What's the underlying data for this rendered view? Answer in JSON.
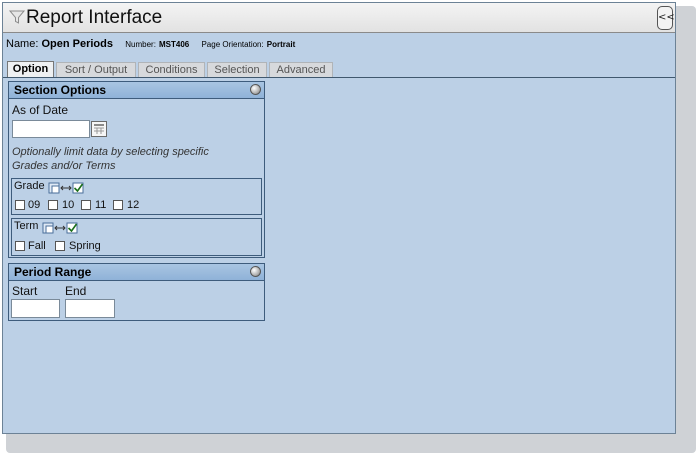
{
  "window": {
    "title": "Report Interface",
    "collapse_label": "<<"
  },
  "report": {
    "name_label": "Name:",
    "name": "Open Periods",
    "number_label": "Number:",
    "number": "MST406",
    "orientation_label": "Page Orientation:",
    "orientation": "Portrait"
  },
  "tabs": [
    "Option",
    "Sort / Output",
    "Conditions",
    "Selection",
    "Advanced"
  ],
  "section_options": {
    "title": "Section Options",
    "as_of_label": "As of Date",
    "as_of_value": "",
    "hint_line1": "Optionally limit data by selecting specific",
    "hint_line2": "Grades and/or Terms",
    "grade": {
      "label": "Grade",
      "options": [
        "09",
        "10",
        "11",
        "12"
      ]
    },
    "term": {
      "label": "Term",
      "options": [
        "Fall",
        "Spring"
      ]
    }
  },
  "period_range": {
    "title": "Period Range",
    "start_label": "Start",
    "end_label": "End",
    "start_value": "",
    "end_value": ""
  },
  "icons": {
    "filter": "funnel-icon",
    "help": "help-icon",
    "calendar": "calendar-icon",
    "select_all_toggle": "select-all-toggle-icon"
  }
}
